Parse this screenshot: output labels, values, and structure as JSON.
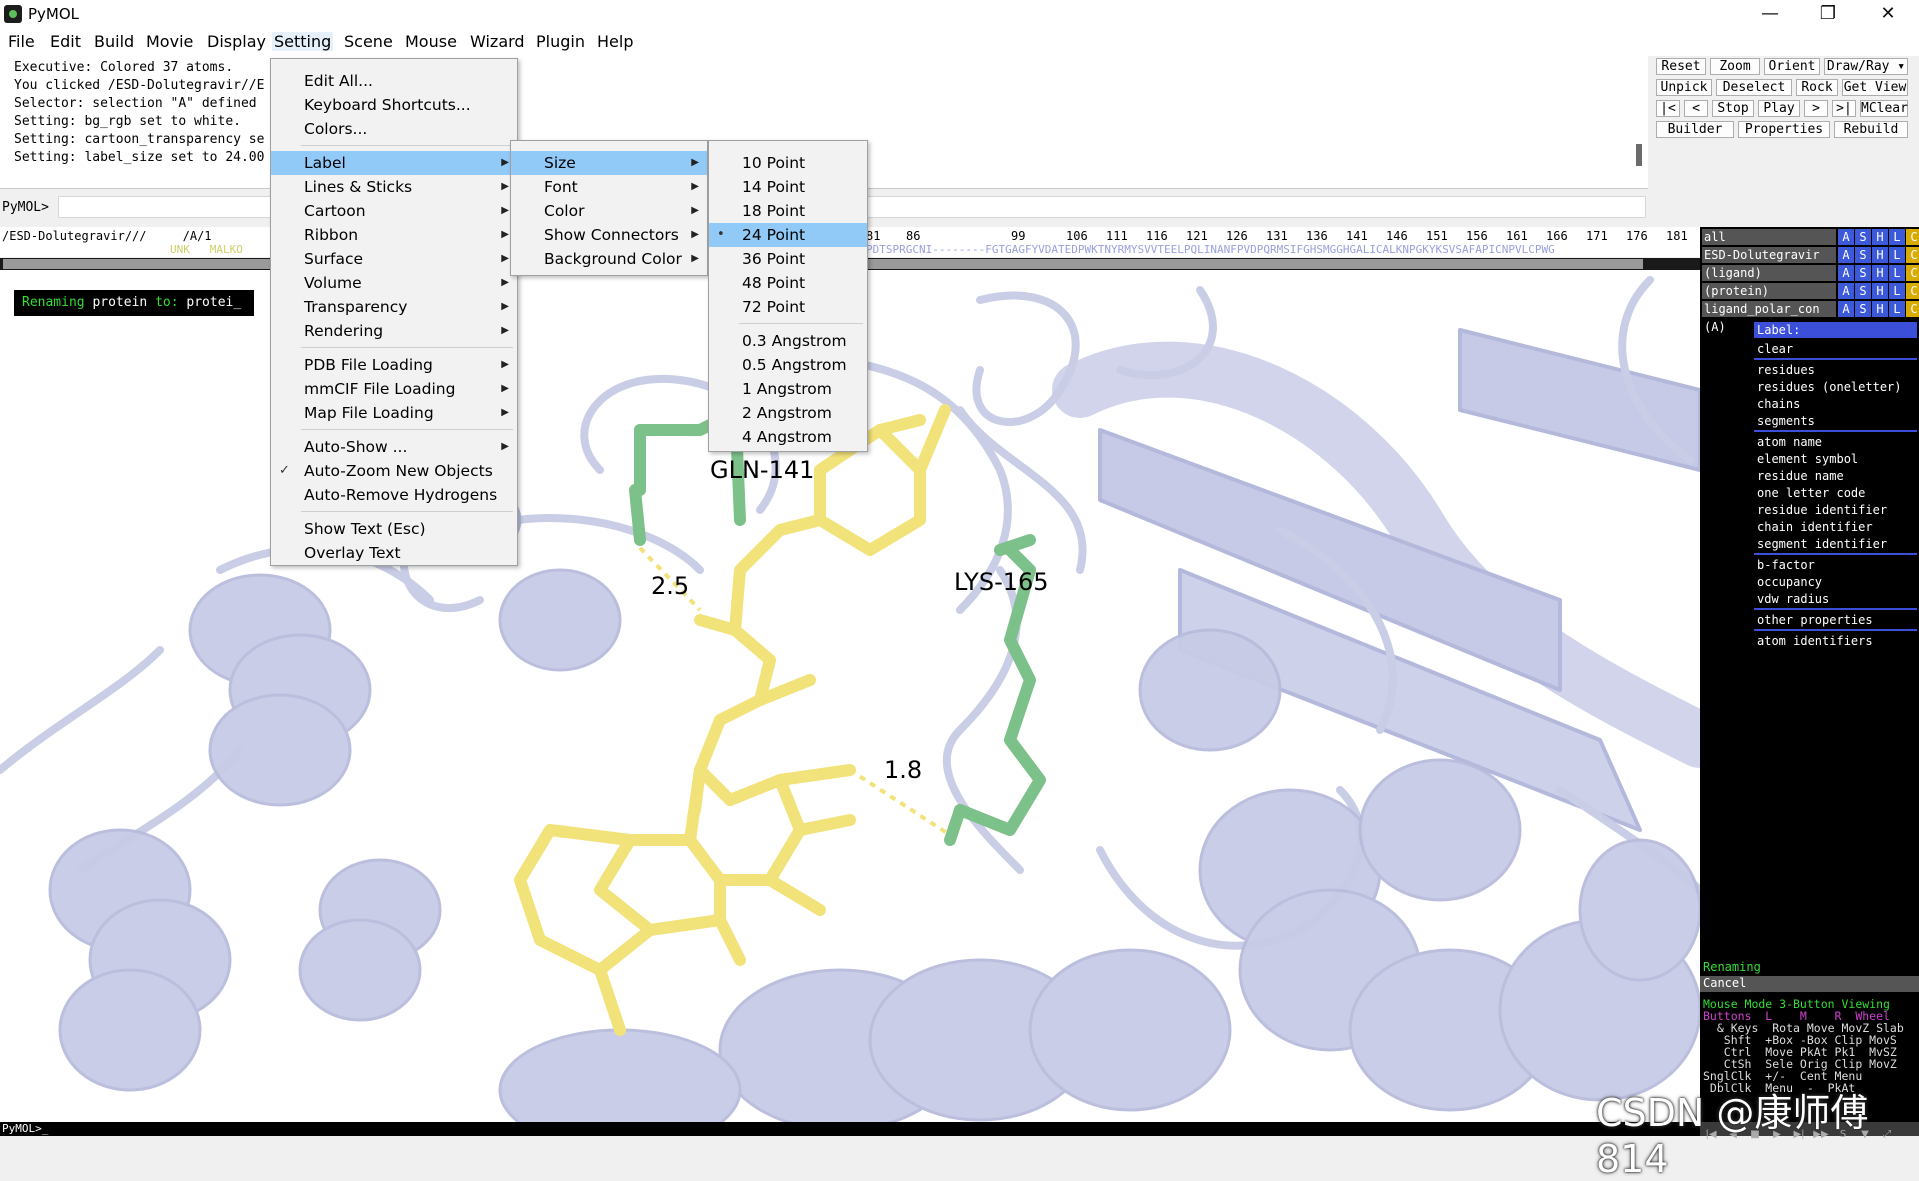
{
  "window": {
    "title": "PyMOL",
    "controls": [
      "—",
      "❐",
      "✕"
    ]
  },
  "menubar": [
    "File",
    "Edit",
    "Build",
    "Movie",
    "Display",
    "Setting",
    "Scene",
    "Mouse",
    "Wizard",
    "Plugin",
    "Help"
  ],
  "console": {
    "lines": [
      "Executive: Colored 37 atoms.",
      "You clicked /ESD-Dolutegravir//E",
      "Selector: selection \"A\" defined",
      "Setting: bg_rgb set to white.",
      "Setting: cartoon_transparency se",
      "Setting: label_size set to 24.00"
    ],
    "prompt": "PyMOL>"
  },
  "buttons": {
    "row1": [
      "Reset",
      "Zoom",
      "Orient",
      "Draw/Ray ▾"
    ],
    "row2": [
      "Unpick",
      "Deselect",
      "Rock",
      "Get View"
    ],
    "row3": [
      "|<",
      "<",
      "Stop",
      "Play",
      ">",
      ">|",
      "MClear"
    ],
    "row4": [
      "Builder",
      "Properties",
      "Rebuild"
    ]
  },
  "sequence": {
    "object": "/ESD-Dolutegravir///     /A/1",
    "residue_numbers": [
      "81",
      "86",
      "99",
      "106",
      "111",
      "116",
      "121",
      "126",
      "131",
      "136",
      "141",
      "146",
      "151",
      "156",
      "161",
      "166",
      "171",
      "176",
      "181"
    ],
    "seq_left": "UNK   MALKO",
    "seq_right": "PDTSPRGCNI--------FGTGAGFYVDATEDPWKTNYRMYSVVTEELPQLINANFPVDPQRMSIFGHSMGGHGALICALKNPGKYKSVSAFAPICNPVLCPWG"
  },
  "viewport": {
    "rename_badge": {
      "prefix": "Renaming",
      "middle": " protein ",
      "to": "to:",
      "value": " protei_"
    },
    "labels": {
      "gln": "GLN-141",
      "lys": "LYS-165",
      "d1": "2.5",
      "d2": "1.8"
    }
  },
  "objects": [
    {
      "name": "all"
    },
    {
      "name": "ESD-Dolutegravir"
    },
    {
      "name": "(ligand)"
    },
    {
      "name": "(protein)"
    },
    {
      "name": "ligand_polar_con"
    },
    {
      "name": "(A)"
    }
  ],
  "ashlc": [
    "A",
    "S",
    "H",
    "L",
    "C"
  ],
  "label_popup": {
    "title": "Label:",
    "groups": [
      [
        "clear"
      ],
      [
        "residues",
        "residues (oneletter)",
        "chains",
        "segments"
      ],
      [
        "atom name",
        "element symbol",
        "residue name",
        "one letter code",
        "residue identifier",
        "chain identifier",
        "segment identifier"
      ],
      [
        "b-factor",
        "occupancy",
        "vdw radius"
      ],
      [
        "other properties"
      ],
      [
        "atom identifiers"
      ]
    ]
  },
  "status": {
    "renaming": "Renaming",
    "cancel": "Cancel"
  },
  "mouse_panel": {
    "header": "Mouse Mode 3-Button Viewing",
    "buttons_row": "Buttons  L    M    R  Wheel",
    "keys_row": "  & Keys  Rota Move MovZ Slab",
    "shft_row": "   Shft  +Box -Box Clip MovS",
    "ctrl_row": "   Ctrl  Move PkAt Pk1  MvSZ",
    "ctsh_row": "   CtSh  Sele Orig Clip MovZ",
    "sngl_row": "SnglClk  +/-  Cent Menu",
    "dbl_row": " DblClk  Menu  -  PkAt"
  },
  "setting_menu": {
    "items": [
      "Edit All...",
      "Keyboard Shortcuts...",
      "Colors...",
      "Label",
      "Lines & Sticks",
      "Cartoon",
      "Ribbon",
      "Surface",
      "Volume",
      "Transparency",
      "Rendering",
      "PDB File Loading",
      "mmCIF File Loading",
      "Map File Loading",
      "Auto-Show ...",
      "Auto-Zoom New Objects",
      "Auto-Remove Hydrogens",
      "Show Text (Esc)",
      "Overlay Text"
    ]
  },
  "label_menu": {
    "items": [
      "Size",
      "Font",
      "Color",
      "Show Connectors",
      "Background Color"
    ]
  },
  "size_menu": {
    "items": [
      "10 Point",
      "14 Point",
      "18 Point",
      "24 Point",
      "36 Point",
      "48 Point",
      "72 Point",
      "0.3 Angstrom",
      "0.5 Angstrom",
      "1 Angstrom",
      "2 Angstrom",
      "4 Angstrom"
    ],
    "selected": "24 Point"
  },
  "bottom": {
    "prompt": "PyMOL>_"
  },
  "watermark": "CSDN @康师傅814",
  "colors": {
    "ligand": "#f2e27a",
    "residue": "#7cc08a",
    "protein": "#c9cde6",
    "highlight": "#91c9f7",
    "panel_blue": "#3c59d9"
  }
}
